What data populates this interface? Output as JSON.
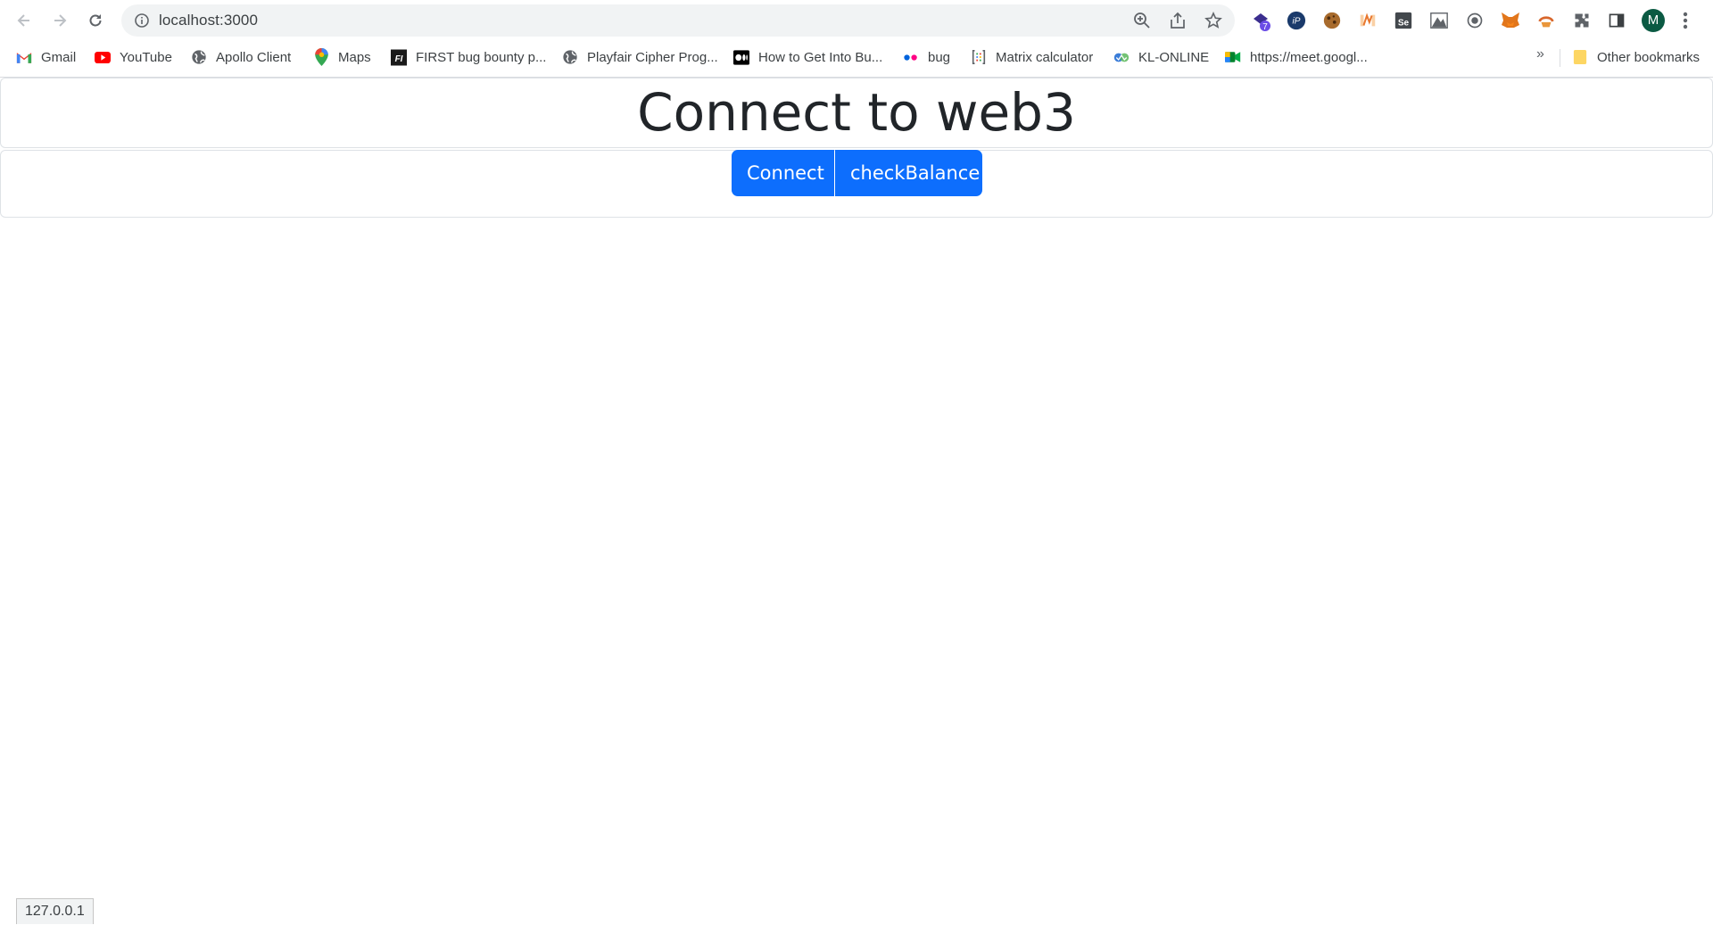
{
  "browser": {
    "url": "localhost:3000",
    "avatar_letter": "M",
    "ext_badge": "7"
  },
  "bookmarks": [
    {
      "label": "Gmail",
      "icon": "gmail-icon"
    },
    {
      "label": "YouTube",
      "icon": "youtube-icon"
    },
    {
      "label": "Apollo Client",
      "icon": "globe-icon"
    },
    {
      "label": "Maps",
      "icon": "maps-pin-icon"
    },
    {
      "label": "FIRST bug bounty p...",
      "icon": "first-icon"
    },
    {
      "label": "Playfair Cipher Prog...",
      "icon": "globe-icon"
    },
    {
      "label": "How to Get Into Bu...",
      "icon": "medium-icon"
    },
    {
      "label": "bug",
      "icon": "flickr-icon"
    },
    {
      "label": "Matrix calculator",
      "icon": "matrix-icon"
    },
    {
      "label": "KL-ONLINE",
      "icon": "kl-online-icon"
    },
    {
      "label": "https://meet.googl...",
      "icon": "meet-icon"
    }
  ],
  "bookmarks_overflow": "»",
  "other_bookmarks": "Other bookmarks",
  "page": {
    "title": "Connect to web3",
    "connect_label": "Connect",
    "check_balance_label": "checkBalance"
  },
  "status_bar": "127.0.0.1",
  "colors": {
    "primary_button": "#0d6efd",
    "title_text": "#212529"
  }
}
